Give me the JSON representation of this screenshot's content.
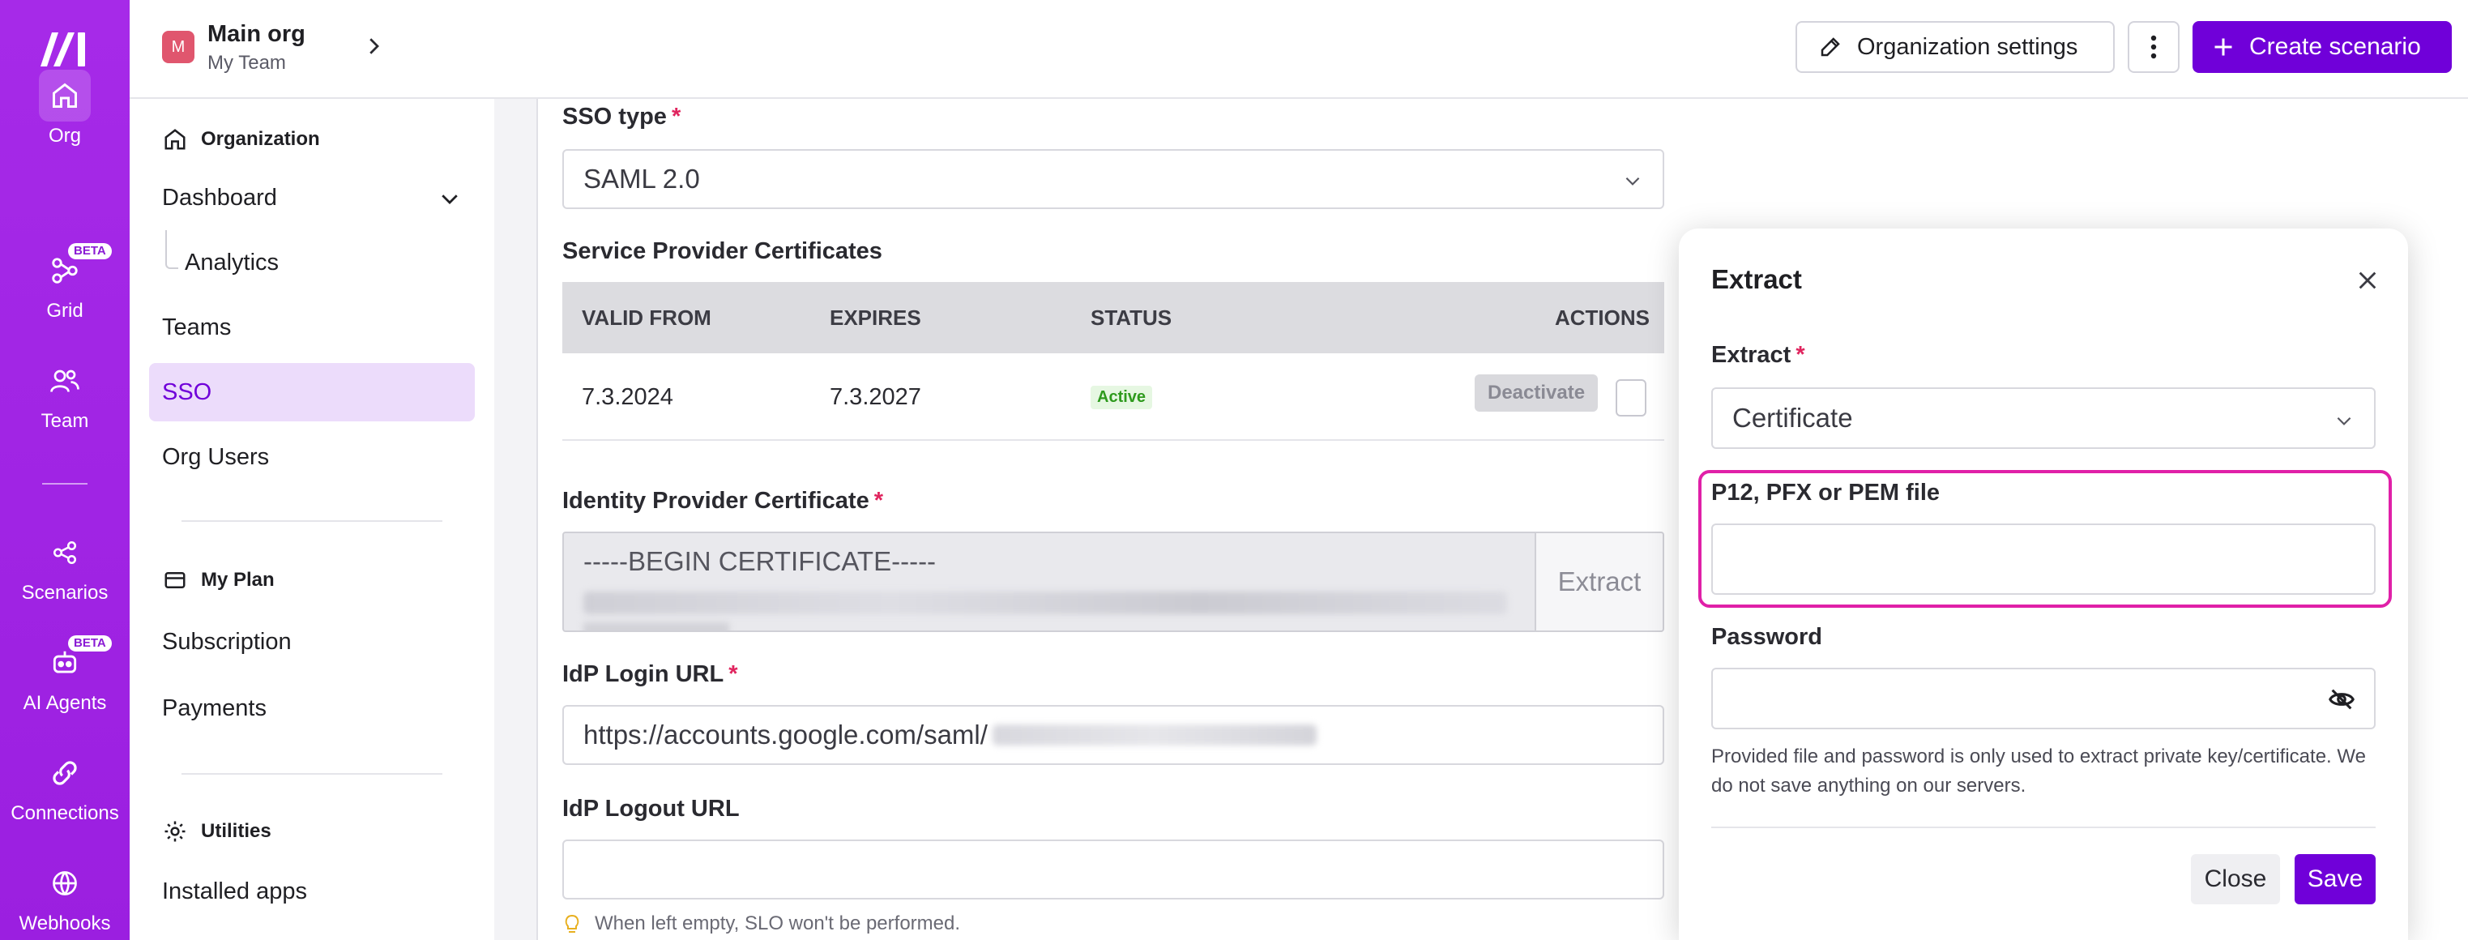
{
  "colors": {
    "rail": "#a629e6",
    "accent": "#7000d9",
    "highlight": "#e020a8",
    "active_badge": "#2e9a1d"
  },
  "rail": {
    "items": [
      {
        "label": "Org",
        "icon": "home-icon",
        "active": true
      },
      {
        "label": "Grid",
        "icon": "grid-nodes-icon",
        "badge": "BETA"
      },
      {
        "label": "Team",
        "icon": "team-icon"
      },
      {
        "label": "Scenarios",
        "icon": "share-nodes-icon"
      },
      {
        "label": "AI Agents",
        "icon": "ai-agent-icon",
        "badge": "BETA"
      },
      {
        "label": "Connections",
        "icon": "link-icon"
      },
      {
        "label": "Webhooks",
        "icon": "globe-icon"
      }
    ]
  },
  "header": {
    "org_initial": "M",
    "org_name": "Main org",
    "team_name": "My Team",
    "settings_label": "Organization settings",
    "create_label": "Create scenario"
  },
  "sidebar": {
    "organization_title": "Organization",
    "dashboard": "Dashboard",
    "analytics": "Analytics",
    "teams": "Teams",
    "sso": "SSO",
    "org_users": "Org Users",
    "plan_title": "My Plan",
    "subscription": "Subscription",
    "payments": "Payments",
    "utilities_title": "Utilities",
    "installed_apps": "Installed apps"
  },
  "form": {
    "sso_type_label": "SSO type",
    "sso_type_value": "SAML 2.0",
    "sp_certs_label": "Service Provider Certificates",
    "columns": [
      "VALID FROM",
      "EXPIRES",
      "STATUS",
      "ACTIONS"
    ],
    "rows": [
      {
        "valid_from": "7.3.2024",
        "expires": "7.3.2027",
        "status": "Active",
        "action": "Deactivate"
      }
    ],
    "idp_cert_label": "Identity Provider Certificate",
    "idp_cert_value": "-----BEGIN CERTIFICATE-----",
    "extract_button": "Extract",
    "idp_login_label": "IdP Login URL",
    "idp_login_value": "https://accounts.google.com/saml/",
    "idp_logout_label": "IdP Logout URL",
    "idp_logout_value": "",
    "logout_hint": "When left empty, SLO won't be performed."
  },
  "modal": {
    "title": "Extract",
    "extract_label": "Extract",
    "extract_value": "Certificate",
    "file_label": "P12, PFX or PEM file",
    "password_label": "Password",
    "note": "Provided file and password is only used to extract private key/certificate. We do not save anything on our servers.",
    "close_button": "Close",
    "save_button": "Save"
  }
}
